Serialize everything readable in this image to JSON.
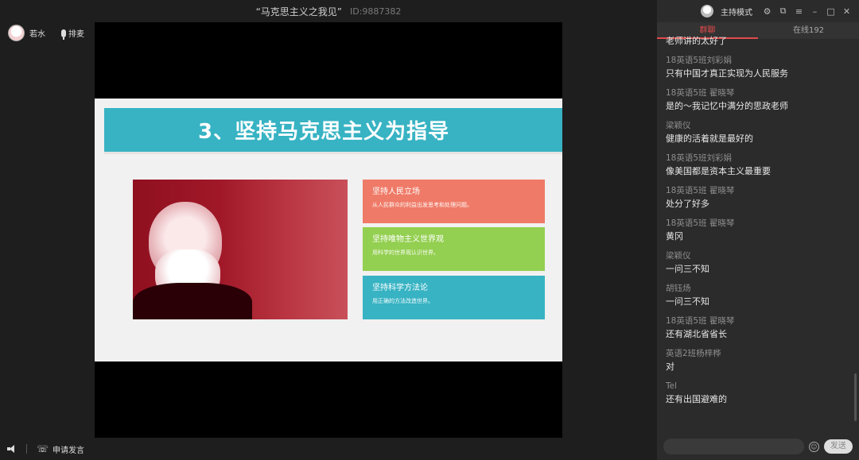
{
  "window": {
    "title": "“马克思主义之我见”",
    "id": "ID:9887382"
  },
  "presenter": {
    "name": "若水",
    "mic_order_label": "排麦"
  },
  "slide": {
    "title": "3、坚持马克思主义为指导",
    "cards": [
      {
        "title": "坚持人民立场",
        "desc": "从人民群众的利益出发思考和处理问题。"
      },
      {
        "title": "坚持唯物主义世界观",
        "desc": "用科学的世界观认识世界。"
      },
      {
        "title": "坚持科学方法论",
        "desc": "用正确的方法改造世界。"
      }
    ],
    "colors": {
      "header": "#37b3c3",
      "card1": "#ef7a67",
      "card2": "#93cf50",
      "card3": "#37b3c3"
    }
  },
  "bottombar": {
    "apply_label": "申请发言"
  },
  "panel": {
    "host_mode_label": "主持模式",
    "tabs": [
      {
        "label": "群聊"
      },
      {
        "label": "在线192"
      }
    ],
    "messages": [
      {
        "user": "",
        "text": "老师讲的太好了"
      },
      {
        "user": "18英语5班刘彩娟",
        "text": "只有中国才真正实现为人民服务"
      },
      {
        "user": "18英语5班 翟晓琴",
        "text": "是的～我记忆中满分的思政老师"
      },
      {
        "user": "梁颖仪",
        "text": "健康的活着就是最好的"
      },
      {
        "user": "18英语5班刘彩娟",
        "text": "像美国都是资本主义最重要"
      },
      {
        "user": "18英语5班 翟晓琴",
        "text": "处分了好多"
      },
      {
        "user": "18英语5班 翟晓琴",
        "text": "黄冈"
      },
      {
        "user": "梁颖仪",
        "text": "一问三不知"
      },
      {
        "user": "胡钰炀",
        "text": "一问三不知"
      },
      {
        "user": "18英语5班 翟晓琴",
        "text": "还有湖北省省长"
      },
      {
        "user": "英语2班杨梓桦",
        "text": "对"
      },
      {
        "user": "Tel",
        "text": "还有出国避难的"
      }
    ],
    "send_label": "发送",
    "accent_color": "#e14a4a"
  }
}
